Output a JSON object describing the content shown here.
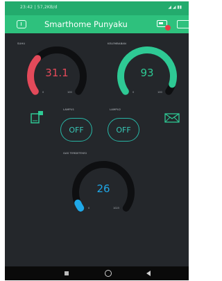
{
  "status_bar": {
    "time": "23:42 | 57,2KB/d",
    "icons": "◢ ◢ ▮▮"
  },
  "app_bar": {
    "title": "Smarthome Punyaku"
  },
  "gauges": {
    "temperature": {
      "label": "SUHU",
      "value": "31.1",
      "min": "0",
      "max": "100",
      "color": "#e34a5a",
      "level": 0.311
    },
    "humidity": {
      "label": "KELEMBABAN",
      "value": "93",
      "min": "0",
      "max": "100",
      "color": "#2ec994",
      "level": 0.93
    },
    "gas": {
      "label": "GAS TERDETEKSI",
      "value": "26",
      "min": "0",
      "max": "1023",
      "color": "#1fa8e8",
      "level": 0.026
    }
  },
  "toggles": {
    "lamp1": {
      "label": "LAMPU1",
      "state": "OFF"
    },
    "lamp2": {
      "label": "LAMPU2",
      "state": "OFF"
    }
  },
  "icons": {
    "left_widget": "tablet-notification-icon",
    "right_widget": "email-icon"
  },
  "colors": {
    "app_bar": "#2ec17d",
    "background": "#24272b",
    "toggle_accent": "#28b6a6"
  }
}
